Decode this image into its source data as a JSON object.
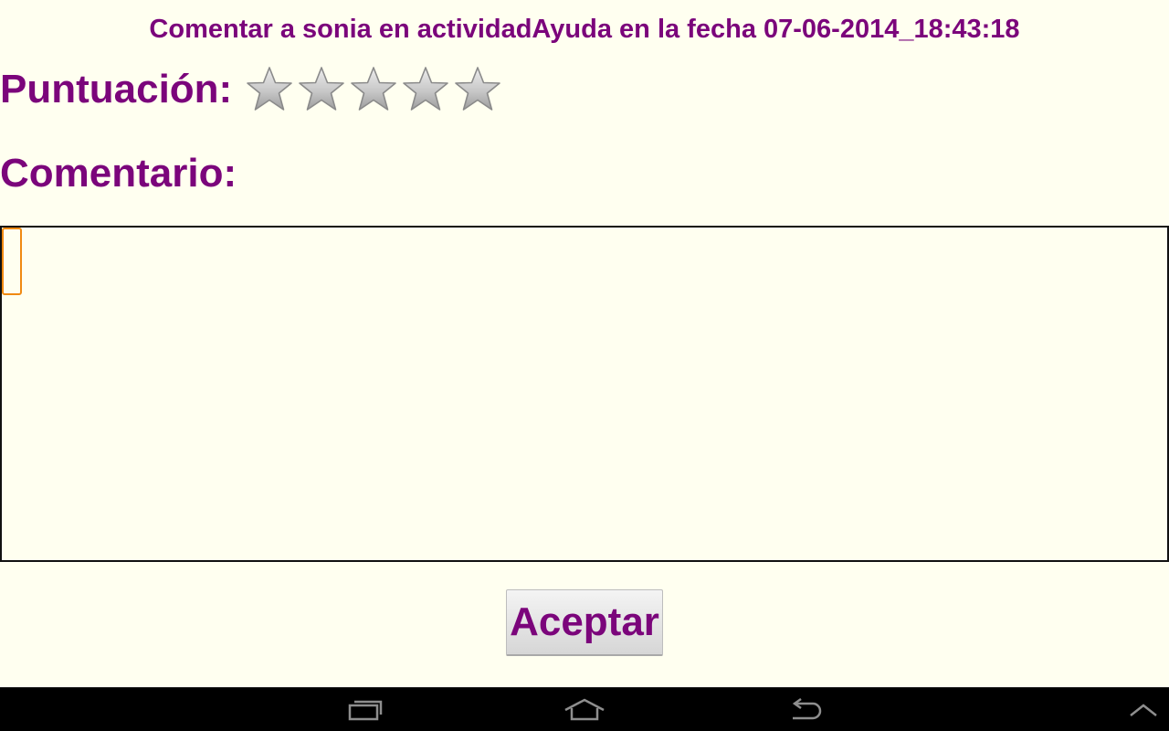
{
  "header": {
    "title": "Comentar a sonia en actividadAyuda en la fecha 07-06-2014_18:43:18"
  },
  "rating": {
    "label": "Puntuación:",
    "value": 0,
    "max": 5
  },
  "comment": {
    "label": "Comentario:",
    "value": "",
    "placeholder": ""
  },
  "actions": {
    "accept_label": "Aceptar"
  },
  "colors": {
    "text_accent": "#7B057B",
    "background": "#FFFFF0",
    "focus": "#F08A12"
  },
  "nav_bar": {
    "icons": [
      "recent-apps-icon",
      "home-icon",
      "back-icon",
      "menu-up-icon"
    ]
  }
}
